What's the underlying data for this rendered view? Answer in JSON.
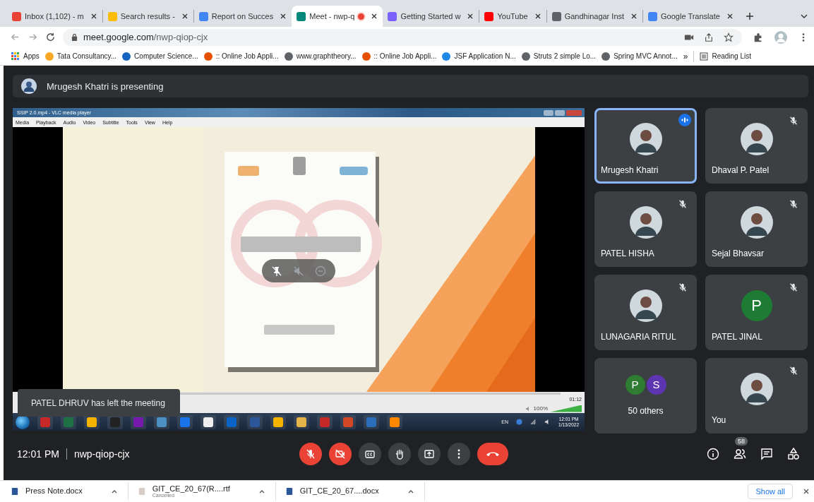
{
  "tabs": [
    {
      "title": "Inbox (1,102) - m",
      "selected": false,
      "recording": false
    },
    {
      "title": "Search results -",
      "selected": false,
      "recording": false
    },
    {
      "title": "Report on Succes",
      "selected": false,
      "recording": false
    },
    {
      "title": "Meet - nwp-q",
      "selected": true,
      "recording": true
    },
    {
      "title": "Getting Started w",
      "selected": false,
      "recording": false
    },
    {
      "title": "YouTube",
      "selected": false,
      "recording": false
    },
    {
      "title": "Gandhinagar Inst",
      "selected": false,
      "recording": false
    },
    {
      "title": "Google Translate",
      "selected": false,
      "recording": false
    }
  ],
  "address": {
    "host": "meet.google.com",
    "path": "/nwp-qiop-cjx"
  },
  "bookmarks": [
    "Apps",
    "Tata Consultancy...",
    "Computer Science...",
    ":: Online Job Appli...",
    "www.graphtheory...",
    ":: Online Job Appli...",
    "JSF Application N...",
    "Struts 2 simple Lo...",
    "Spring MVC Annot..."
  ],
  "bookmarks_overflow": "»",
  "reading_list": "Reading List",
  "presenting_banner": "Mrugesh Khatri is presenting",
  "shared_screen": {
    "window_title": "SSIP 2.0.mp4 - VLC media player",
    "menu": [
      "Media",
      "Playback",
      "Audio",
      "Video",
      "Subtitle",
      "Tools",
      "View",
      "Help"
    ],
    "time": "01:12",
    "volume": "100%",
    "level": 1,
    "language": "EN",
    "clock_time": "12:01 PM",
    "clock_date": "1/13/2022"
  },
  "toast": "PATEL DHRUV has left the meeting",
  "participants": [
    {
      "name": "Mrugesh Khatri",
      "muted": false,
      "speaking": true
    },
    {
      "name": "Dhaval P. Patel",
      "muted": true,
      "speaking": false
    },
    {
      "name": "PATEL HISHA",
      "muted": true,
      "speaking": false
    },
    {
      "name": "Sejal Bhavsar",
      "muted": true,
      "speaking": false
    },
    {
      "name": "LUNAGARIA RITUL",
      "muted": true,
      "speaking": false
    },
    {
      "name": "PATEL JINAL",
      "kind": "letter",
      "letters": [
        {
          "letter": "P",
          "color": "#1e7b34"
        }
      ],
      "muted": true,
      "speaking": false
    },
    {
      "name": "50 others",
      "kind": "group",
      "letters": [
        {
          "letter": "P",
          "color": "#2e7d32"
        },
        {
          "letter": "S",
          "color": "#5e35b1"
        }
      ],
      "muted": false,
      "speaking": false
    },
    {
      "name": "You",
      "muted": true,
      "speaking": false
    }
  ],
  "call_bar": {
    "time": "12:01 PM",
    "meeting_code": "nwp-qiop-cjx",
    "controls": [
      {
        "kind": "mic",
        "off": true
      },
      {
        "kind": "camera",
        "off": true
      },
      {
        "kind": "captions",
        "off": false
      },
      {
        "kind": "hand",
        "off": false
      },
      {
        "kind": "present",
        "off": false
      },
      {
        "kind": "more",
        "off": false
      },
      {
        "kind": "leave"
      }
    ],
    "people_count": "58"
  },
  "downloads": [
    {
      "name": "Press Note.docx"
    },
    {
      "name": "GIT_CE_20_67(R....rtf",
      "status": "Cancelled"
    },
    {
      "name": "GIT_CE_20_67....docx"
    }
  ],
  "show_all": "Show all"
}
